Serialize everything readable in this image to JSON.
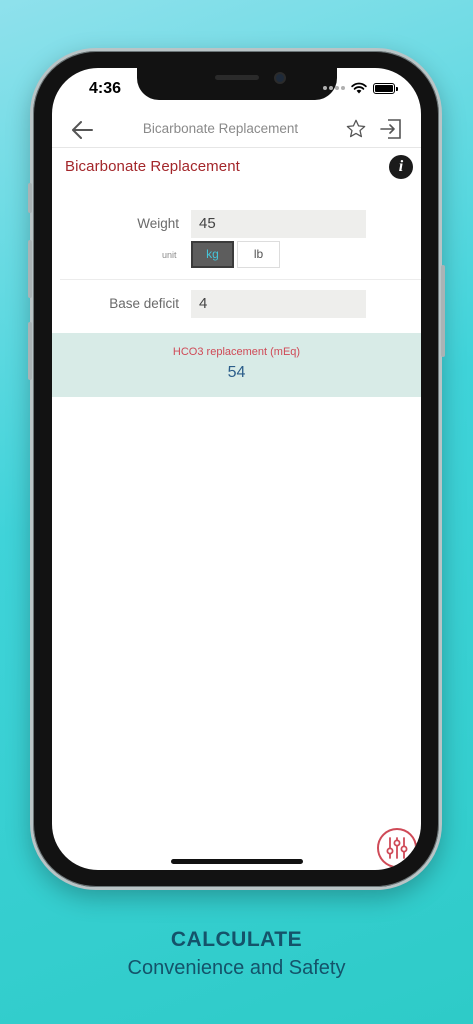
{
  "status": {
    "time": "4:36"
  },
  "navbar": {
    "title": "Bicarbonate Replacement"
  },
  "calculator": {
    "title": "Bicarbonate Replacement",
    "info_label": "i",
    "weight": {
      "label": "Weight",
      "value": "45"
    },
    "unit": {
      "label": "unit",
      "options": [
        "kg",
        "lb"
      ],
      "selected": "kg"
    },
    "base_deficit": {
      "label": "Base deficit",
      "value": "4"
    },
    "result": {
      "label": "HCO3 replacement (mEq)",
      "value": "54"
    }
  },
  "caption": {
    "title": "CALCULATE",
    "subtitle": "Convenience and Safety"
  },
  "colors": {
    "title_red": "#a3262a",
    "result_band": "#d8ebe7",
    "result_label": "#cf4a57",
    "result_value": "#2b5d8a",
    "selected_unit_text": "#45c4d8",
    "caption": "#14536a"
  },
  "icons": [
    "back-arrow-icon",
    "star-icon",
    "exit-icon",
    "info-icon",
    "sliders-icon",
    "wifi-icon",
    "battery-icon",
    "signal-icon"
  ]
}
